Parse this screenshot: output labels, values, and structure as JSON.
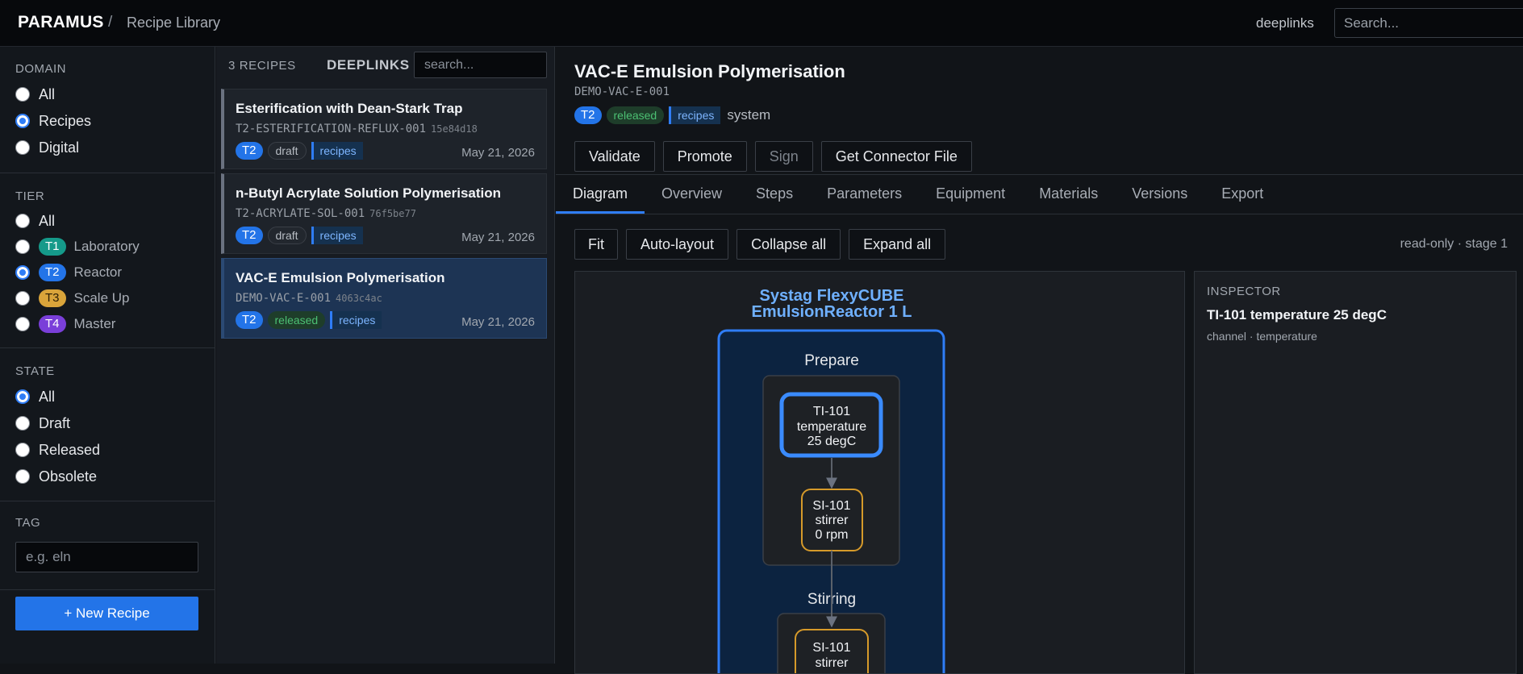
{
  "topbar": {
    "brand": "PARAMUS",
    "separator": "/",
    "crumb": "Recipe Library",
    "link": "deeplinks",
    "search_placeholder": "Search..."
  },
  "sidebar": {
    "domain": {
      "title": "DOMAIN",
      "options": [
        "All",
        "Recipes",
        "Digital"
      ],
      "selected": "Recipes"
    },
    "tier": {
      "title": "TIER",
      "all": "All",
      "options": [
        {
          "badge": "T1",
          "label": "Laboratory",
          "color": "#159a8a"
        },
        {
          "badge": "T2",
          "label": "Reactor",
          "color": "#2374e8"
        },
        {
          "badge": "T3",
          "label": "Scale Up",
          "color": "#d9a43a"
        },
        {
          "badge": "T4",
          "label": "Master",
          "color": "#7a3fd9"
        }
      ],
      "selected": "T2"
    },
    "state": {
      "title": "STATE",
      "options": [
        "All",
        "Draft",
        "Released",
        "Obsolete"
      ],
      "selected": "All"
    },
    "tag": {
      "title": "TAG",
      "placeholder": "e.g. eln"
    },
    "new_button": "+ New Recipe"
  },
  "list": {
    "count": "3 RECIPES",
    "deeplinks": "DEEPLINKS",
    "search_placeholder": "search...",
    "items": [
      {
        "title": "Esterification with Dean-Stark Trap",
        "id": "T2-ESTERIFICATION-REFLUX-001",
        "hash": "15e84d18",
        "tier": "T2",
        "state": "draft",
        "tag": "recipes",
        "date": "May 21, 2026"
      },
      {
        "title": "n-Butyl Acrylate Solution Polymerisation",
        "id": "T2-ACRYLATE-SOL-001",
        "hash": "76f5be77",
        "tier": "T2",
        "state": "draft",
        "tag": "recipes",
        "date": "May 21, 2026"
      },
      {
        "title": "VAC-E Emulsion Polymerisation",
        "id": "DEMO-VAC-E-001",
        "hash": "4063c4ac",
        "tier": "T2",
        "state": "released",
        "tag": "recipes",
        "date": "May 21, 2026",
        "selected": true
      }
    ]
  },
  "detail": {
    "title": "VAC-E Emulsion Polymerisation",
    "id": "DEMO-VAC-E-001",
    "tier": "T2",
    "state": "released",
    "tag": "recipes",
    "owner": "system",
    "actions": [
      "Validate",
      "Promote",
      "Sign",
      "Get Connector File"
    ],
    "tabs": [
      "Diagram",
      "Overview",
      "Steps",
      "Parameters",
      "Equipment",
      "Materials",
      "Versions",
      "Export"
    ],
    "active_tab": "Diagram",
    "toolbar": [
      "Fit",
      "Auto-layout",
      "Collapse all",
      "Expand all"
    ],
    "mode": "read-only · stage 1"
  },
  "diagram": {
    "equipment_line1": "Systag FlexyCUBE",
    "equipment_line2": "EmulsionReactor 1 L",
    "groups": [
      {
        "name": "Prepare",
        "nodes": [
          {
            "lines": [
              "TI-101",
              "temperature",
              "25 degC"
            ],
            "kind": "temperature",
            "selected": true
          },
          {
            "lines": [
              "SI-101",
              "stirrer",
              "0 rpm"
            ],
            "kind": "stirrer"
          }
        ]
      },
      {
        "name": "Stirring",
        "nodes": [
          {
            "lines": [
              "SI-101",
              "stirrer"
            ],
            "kind": "stirrer"
          }
        ]
      }
    ],
    "colors": {
      "reactor_border": "#2f7df6",
      "selected_node": "#3a8bff",
      "stirrer_node": "#d69a2a",
      "equipment_title": "#6fb0ff"
    }
  },
  "inspector": {
    "title": "INSPECTOR",
    "name": "TI-101 temperature 25 degC",
    "sub": "channel · temperature"
  }
}
